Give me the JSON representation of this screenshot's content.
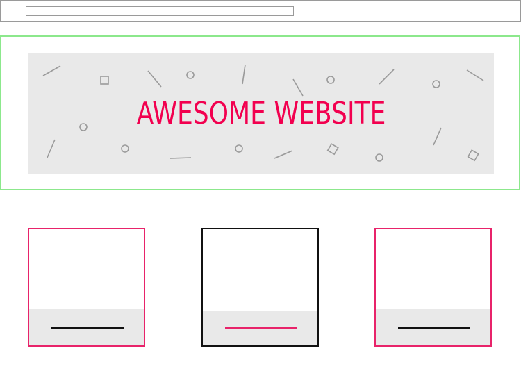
{
  "browser": {
    "address": ""
  },
  "hero": {
    "title": "AWESOME WEBSITE",
    "title_color": "#f2004f",
    "background_color": "#e9e9e9",
    "frame_color": "#8ce88c"
  },
  "cards": [
    {
      "border_color": "#e8236a",
      "caption_line_color": "#111111"
    },
    {
      "border_color": "#111111",
      "caption_line_color": "#e8236a"
    },
    {
      "border_color": "#e8236a",
      "caption_line_color": "#111111"
    }
  ]
}
